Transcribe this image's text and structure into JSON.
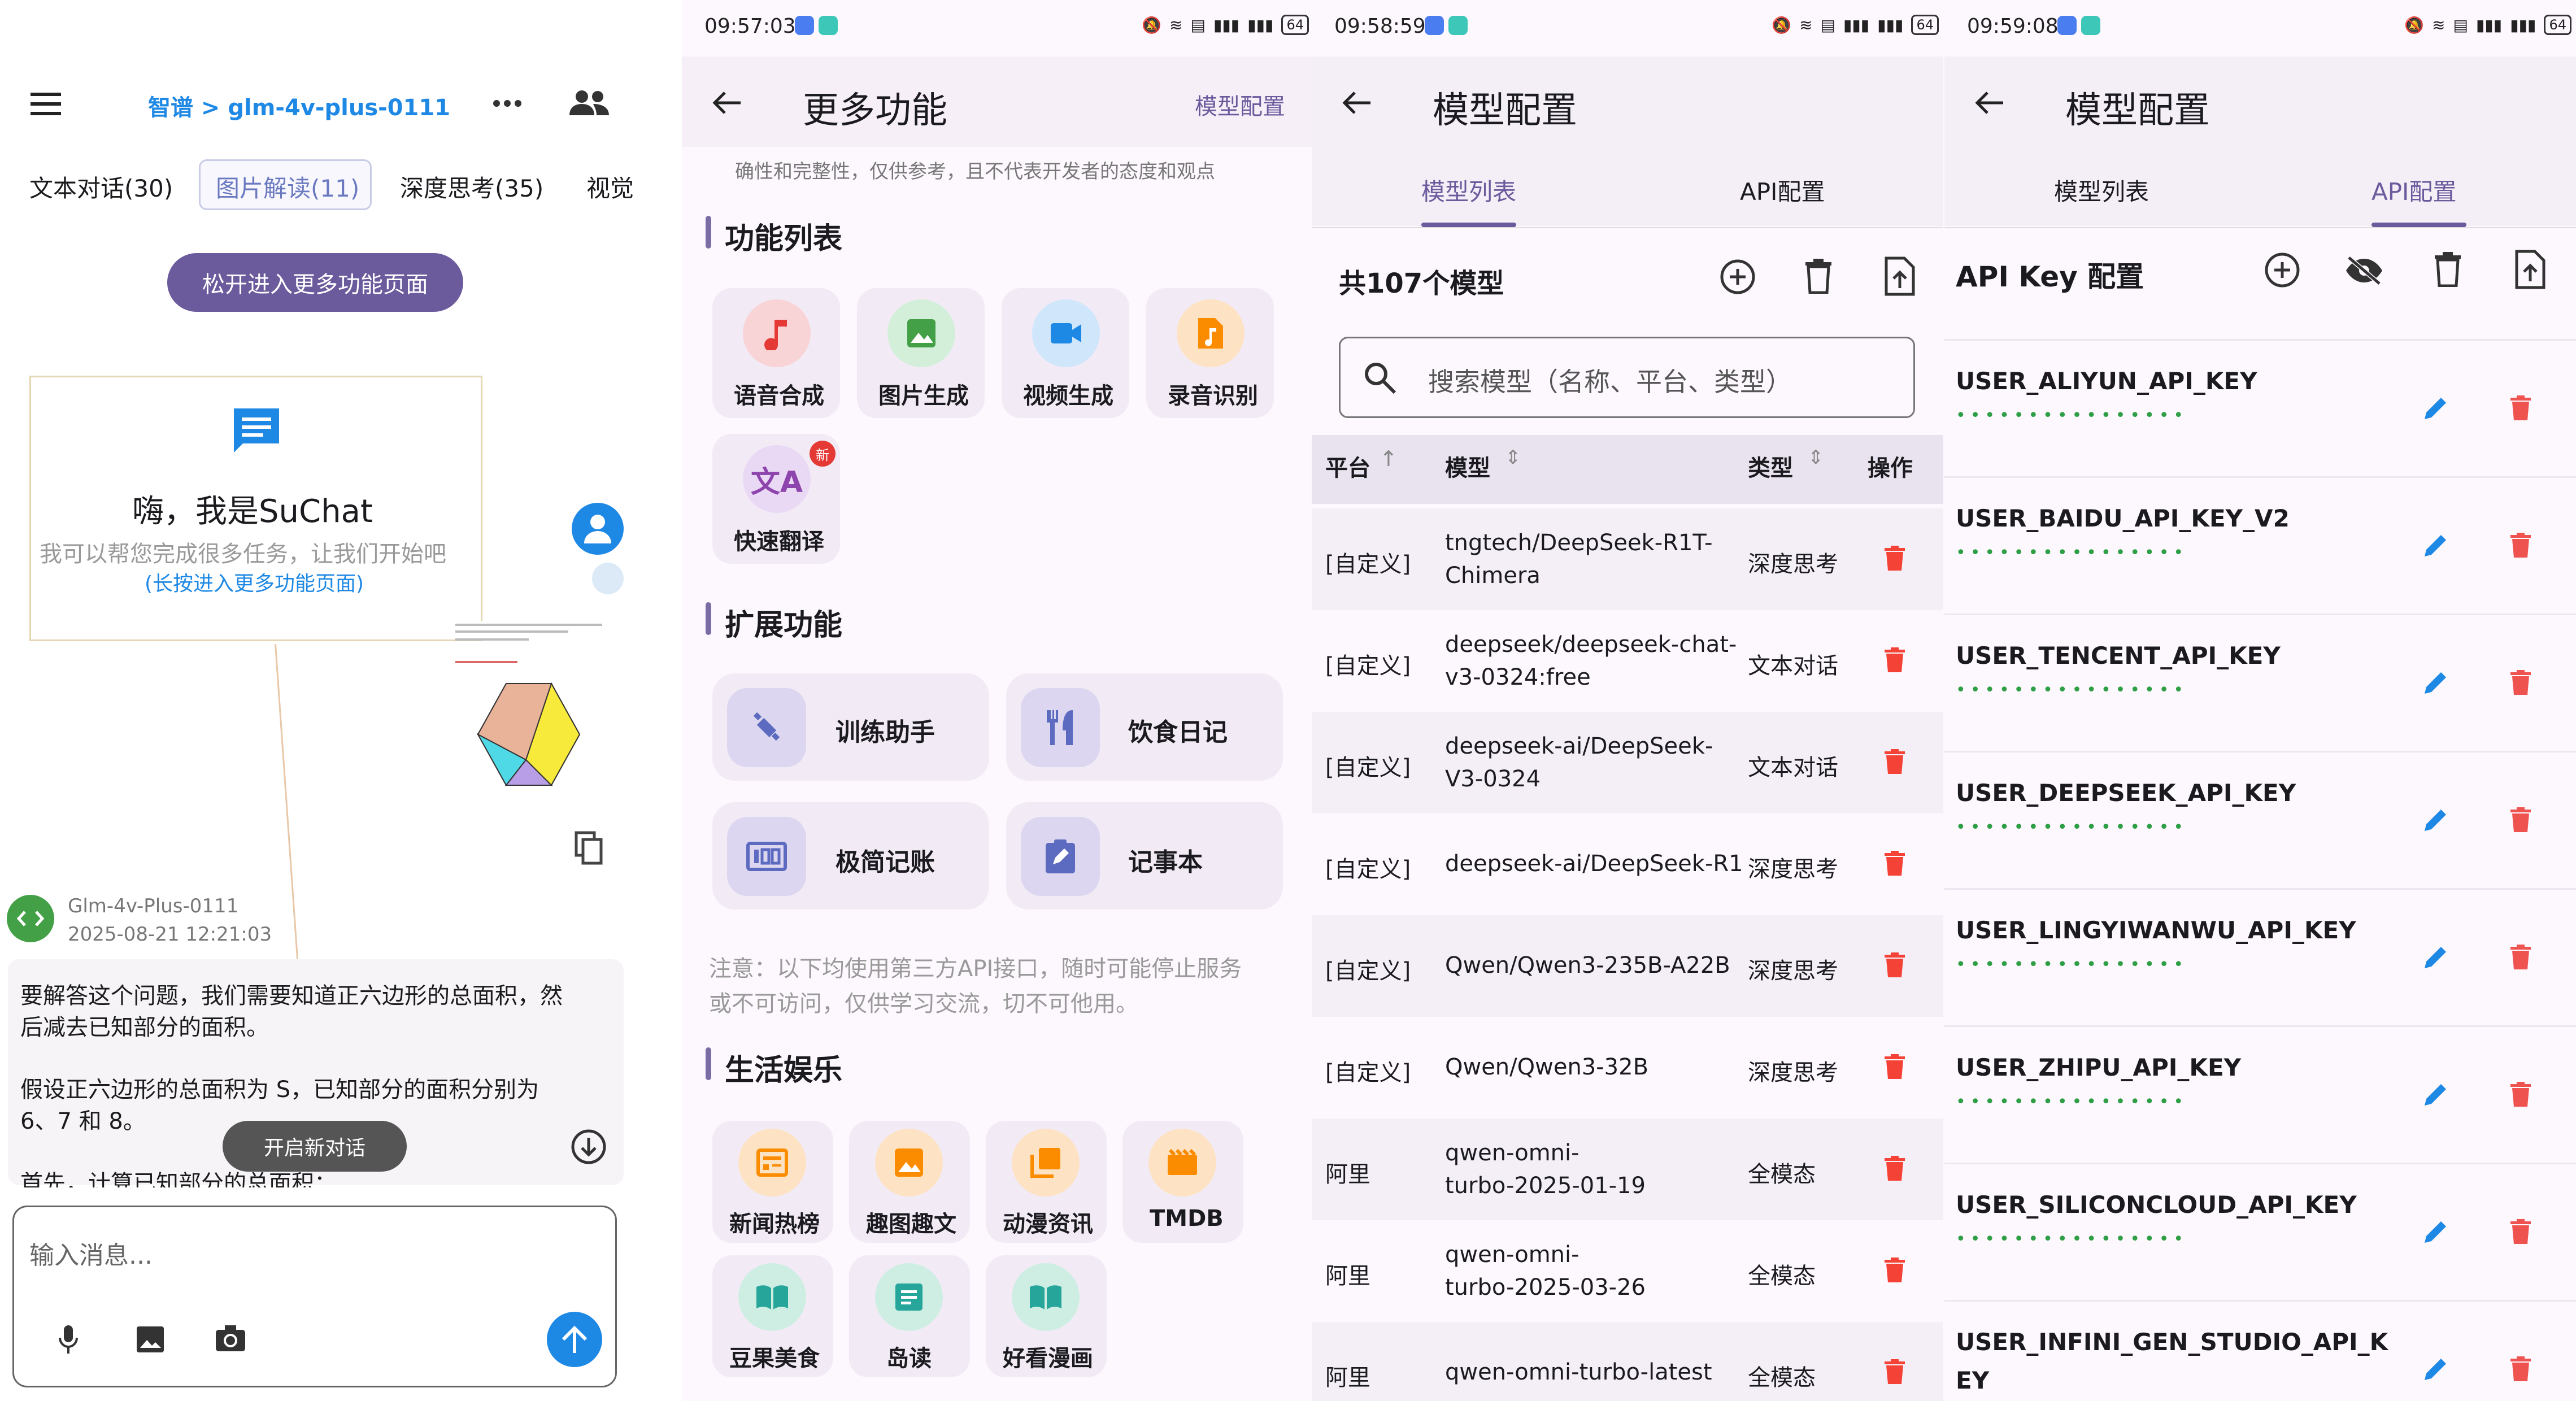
{
  "panel1": {
    "status_time": "",
    "header_title": "智谱 > glm-4v-plus-0111",
    "tabs": [
      "文本对话(30)",
      "图片解读(11)",
      "深度思考(35)",
      "视觉"
    ],
    "release_hint": "松开进入更多功能页面",
    "welcome_title": "嗨，我是SuChat",
    "welcome_sub": "我可以帮您完成很多任务，让我们开始吧",
    "welcome_link": "(长按进入更多功能页面)",
    "msg_author": "Glm-4v-Plus-0111",
    "msg_time": "2025-08-21 12:21:03",
    "msg_p1": "要解答这个问题，我们需要知道正六边形的总面积，然后减去已知部分的面积。",
    "msg_p1_l1": "要解答这个问题，我们需要知道正六边形的总面积，然",
    "msg_p1_l2": "后减去已知部分的面积。",
    "msg_p2_l1": "假设正六边形的总面积为 S，已知部分的面积分别为",
    "msg_p2_l2": "6、7 和 8。",
    "msg_p3": "首先，计算已知部分的总面积：",
    "new_chat": "开启新对话",
    "input_placeholder": "输入消息..."
  },
  "panel2": {
    "status_time": "09:57:03",
    "title": "更多功能",
    "right_action": "模型配置",
    "disclaimer_l1": "确性和完整性，仅供参考，且不代表开发者的态度和观点",
    "section1": "功能列表",
    "features": [
      {
        "label": "语音合成",
        "color": "#f9d4d6",
        "icon": "music-note-icon"
      },
      {
        "label": "图片生成",
        "color": "#d3efd9",
        "icon": "image-icon"
      },
      {
        "label": "视频生成",
        "color": "#d0e6fa",
        "icon": "video-icon"
      },
      {
        "label": "录音识别",
        "color": "#fde3c4",
        "icon": "audio-file-icon"
      },
      {
        "label": "快速翻译",
        "color": "#ead9f5",
        "icon": "translate-icon"
      }
    ],
    "new_badge": "新",
    "section2": "扩展功能",
    "extensions": [
      {
        "label": "训练助手",
        "icon": "fitness-icon"
      },
      {
        "label": "饮食日记",
        "icon": "restaurant-icon"
      },
      {
        "label": "极简记账",
        "icon": "counter-icon"
      },
      {
        "label": "记事本",
        "icon": "note-edit-icon"
      }
    ],
    "note_l1": "注意：以下均使用第三方API接口，随时可能停止服务",
    "note_l2": "或不可访问，仅供学习交流，切不可他用。",
    "section3": "生活娱乐",
    "entertainment": [
      {
        "label": "新闻热榜",
        "icon": "news-icon"
      },
      {
        "label": "趣图趣文",
        "icon": "picture-icon"
      },
      {
        "label": "动漫资讯",
        "icon": "collection-icon"
      },
      {
        "label": "TMDB",
        "icon": "movie-icon"
      },
      {
        "label": "豆果美食",
        "icon": "menu-book-icon"
      },
      {
        "label": "岛读",
        "icon": "article-icon"
      },
      {
        "label": "好看漫画",
        "icon": "open-book-icon"
      }
    ]
  },
  "panel3": {
    "status_time": "09:58:59",
    "title": "模型配置",
    "tabs": [
      "模型列表",
      "API配置"
    ],
    "count": "共107个模型",
    "search_placeholder": "搜索模型（名称、平台、类型）",
    "columns": [
      "平台",
      "模型",
      "类型",
      "操作"
    ],
    "rows": [
      {
        "platform": "[自定义]",
        "model_l1": "tngtech/DeepSeek-R1T-",
        "model_l2": "Chimera",
        "type": "深度思考"
      },
      {
        "platform": "[自定义]",
        "model_l1": "deepseek/deepseek-chat-",
        "model_l2": "v3-0324:free",
        "type": "文本对话"
      },
      {
        "platform": "[自定义]",
        "model_l1": "deepseek-ai/DeepSeek-",
        "model_l2": "V3-0324",
        "type": "文本对话"
      },
      {
        "platform": "[自定义]",
        "model_l1": "deepseek-ai/DeepSeek-R1",
        "model_l2": "",
        "type": "深度思考"
      },
      {
        "platform": "[自定义]",
        "model_l1": "Qwen/Qwen3-235B-A22B",
        "model_l2": "",
        "type": "深度思考"
      },
      {
        "platform": "[自定义]",
        "model_l1": "Qwen/Qwen3-32B",
        "model_l2": "",
        "type": "深度思考"
      },
      {
        "platform": "阿里",
        "model_l1": "qwen-omni-",
        "model_l2": "turbo-2025-01-19",
        "type": "全模态"
      },
      {
        "platform": "阿里",
        "model_l1": "qwen-omni-",
        "model_l2": "turbo-2025-03-26",
        "type": "全模态"
      },
      {
        "platform": "阿里",
        "model_l1": "qwen-omni-turbo-latest",
        "model_l2": "",
        "type": "全模态"
      }
    ]
  },
  "panel4": {
    "status_time": "09:59:08",
    "title": "模型配置",
    "tabs": [
      "模型列表",
      "API配置"
    ],
    "header": "API Key 配置",
    "keys": [
      {
        "name": "USER_ALIYUN_API_KEY",
        "name_l2": ""
      },
      {
        "name": "USER_BAIDU_API_KEY_V2",
        "name_l2": ""
      },
      {
        "name": "USER_TENCENT_API_KEY",
        "name_l2": ""
      },
      {
        "name": "USER_DEEPSEEK_API_KEY",
        "name_l2": ""
      },
      {
        "name": "USER_LINGYIWANWU_API_KEY",
        "name_l2": ""
      },
      {
        "name": "USER_ZHIPU_API_KEY",
        "name_l2": ""
      },
      {
        "name": "USER_SILICONCLOUD_API_KEY",
        "name_l2": ""
      },
      {
        "name": "USER_INFINI_GEN_STUDIO_API_K",
        "name_l2": "EY"
      }
    ],
    "masked": "••••••••••••••••"
  },
  "colors": {
    "accent": "#6b5a9c",
    "link_blue": "#1e88e5",
    "trash_red": "#f44336",
    "masked_green": "#2e9f45"
  }
}
